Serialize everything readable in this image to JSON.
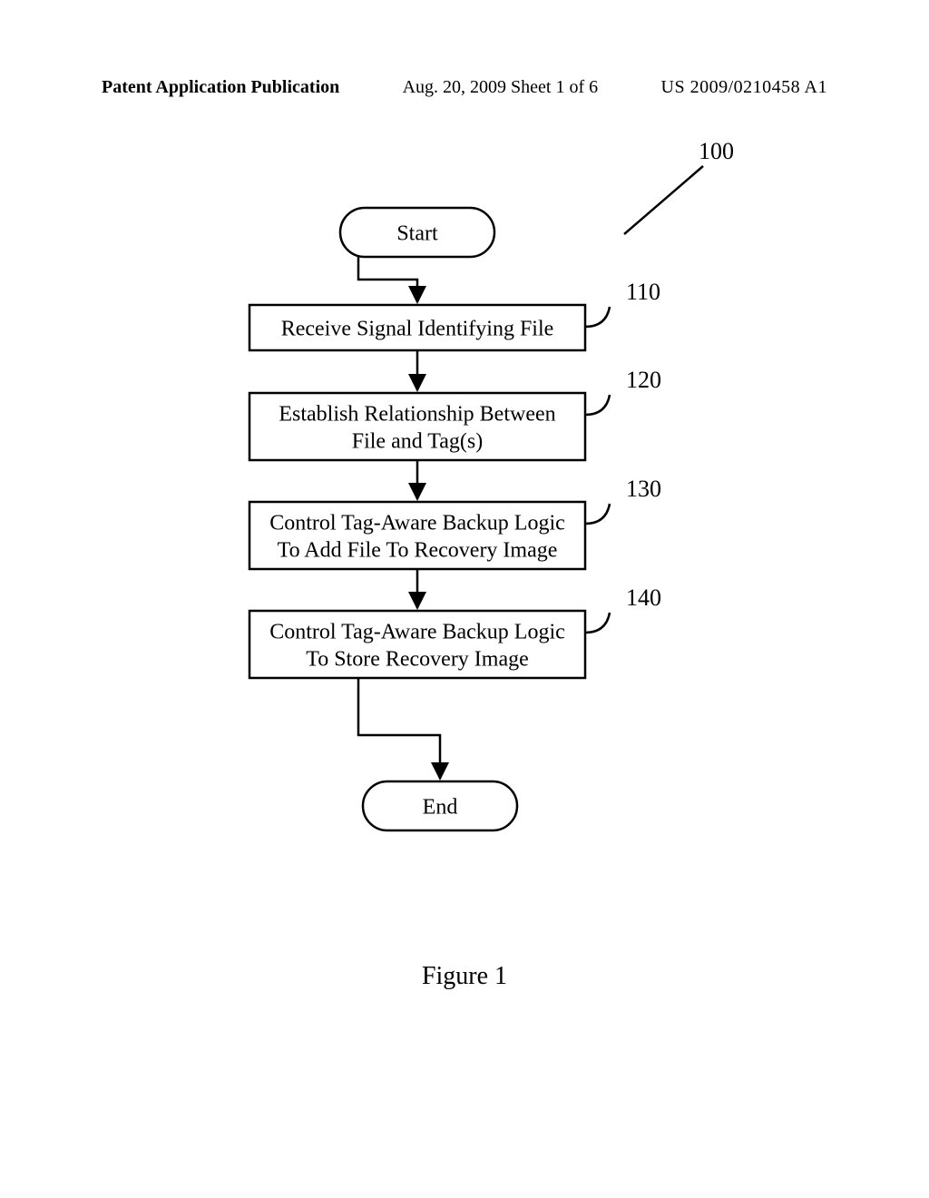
{
  "header": {
    "left": "Patent Application Publication",
    "center": "Aug. 20, 2009  Sheet 1 of 6",
    "right": "US 2009/0210458 A1"
  },
  "figure_caption": "Figure 1",
  "refs": {
    "overall": "100",
    "step1": "110",
    "step2": "120",
    "step3": "130",
    "step4": "140"
  },
  "nodes": {
    "start": "Start",
    "step1": "Receive Signal Identifying File",
    "step2_line1": "Establish Relationship Between",
    "step2_line2": "File and Tag(s)",
    "step3_line1": "Control Tag-Aware Backup Logic",
    "step3_line2": "To Add File To Recovery Image",
    "step4_line1": "Control Tag-Aware Backup Logic",
    "step4_line2": "To Store Recovery Image",
    "end": "End"
  }
}
